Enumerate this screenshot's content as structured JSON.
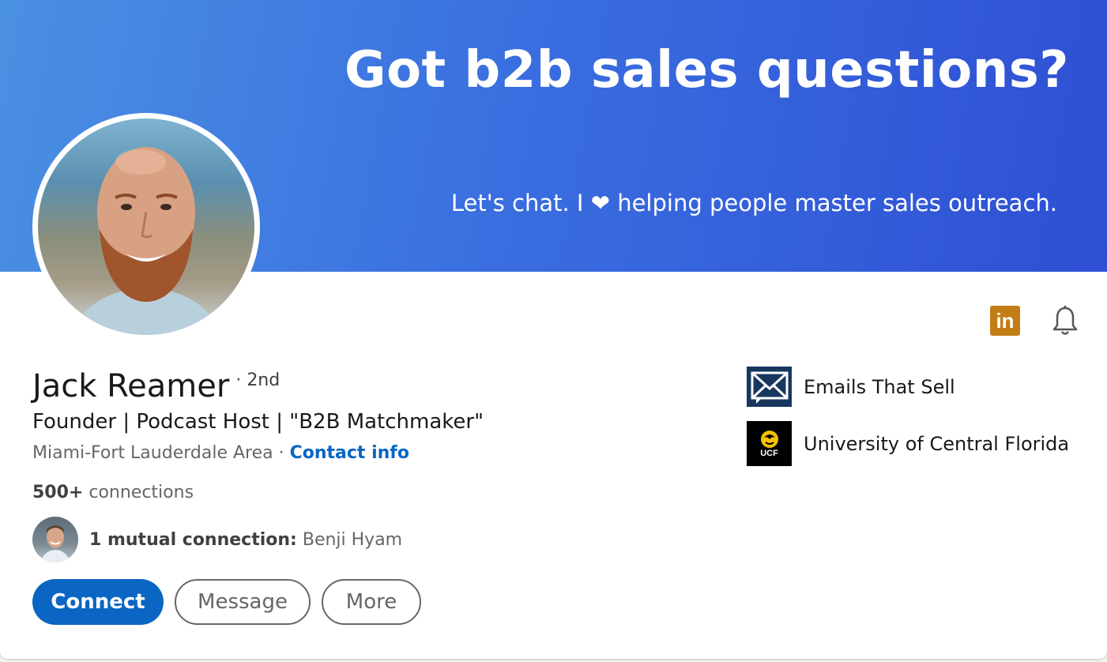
{
  "banner": {
    "headline": "Got b2b sales questions?",
    "subline": "Let's chat. I ❤ helping people master sales outreach."
  },
  "profile": {
    "name": "Jack Reamer",
    "degree": "· 2nd",
    "headline": "Founder | Podcast Host | \"B2B Matchmaker\"",
    "location": "Miami-Fort Lauderdale Area",
    "location_sep": " · ",
    "contact_info_label": "Contact info",
    "connections_count": "500+",
    "connections_label": " connections",
    "mutual_count_label": "1 mutual connection:",
    "mutual_name": " Benji Hyam"
  },
  "actions": {
    "connect_label": "Connect",
    "message_label": "Message",
    "more_label": "More",
    "linkedin_icon_text": "in"
  },
  "side": {
    "items": [
      {
        "label": "Emails That Sell",
        "icon": "envelope-logo"
      },
      {
        "label": "University of Central Florida",
        "icon": "ucf-logo",
        "logo_text": "UCF"
      }
    ]
  },
  "colors": {
    "accent": "#0a66c2",
    "linkedin_badge": "#c37d16",
    "banner_start": "#4a90e2",
    "banner_end": "#2e4fd4"
  }
}
